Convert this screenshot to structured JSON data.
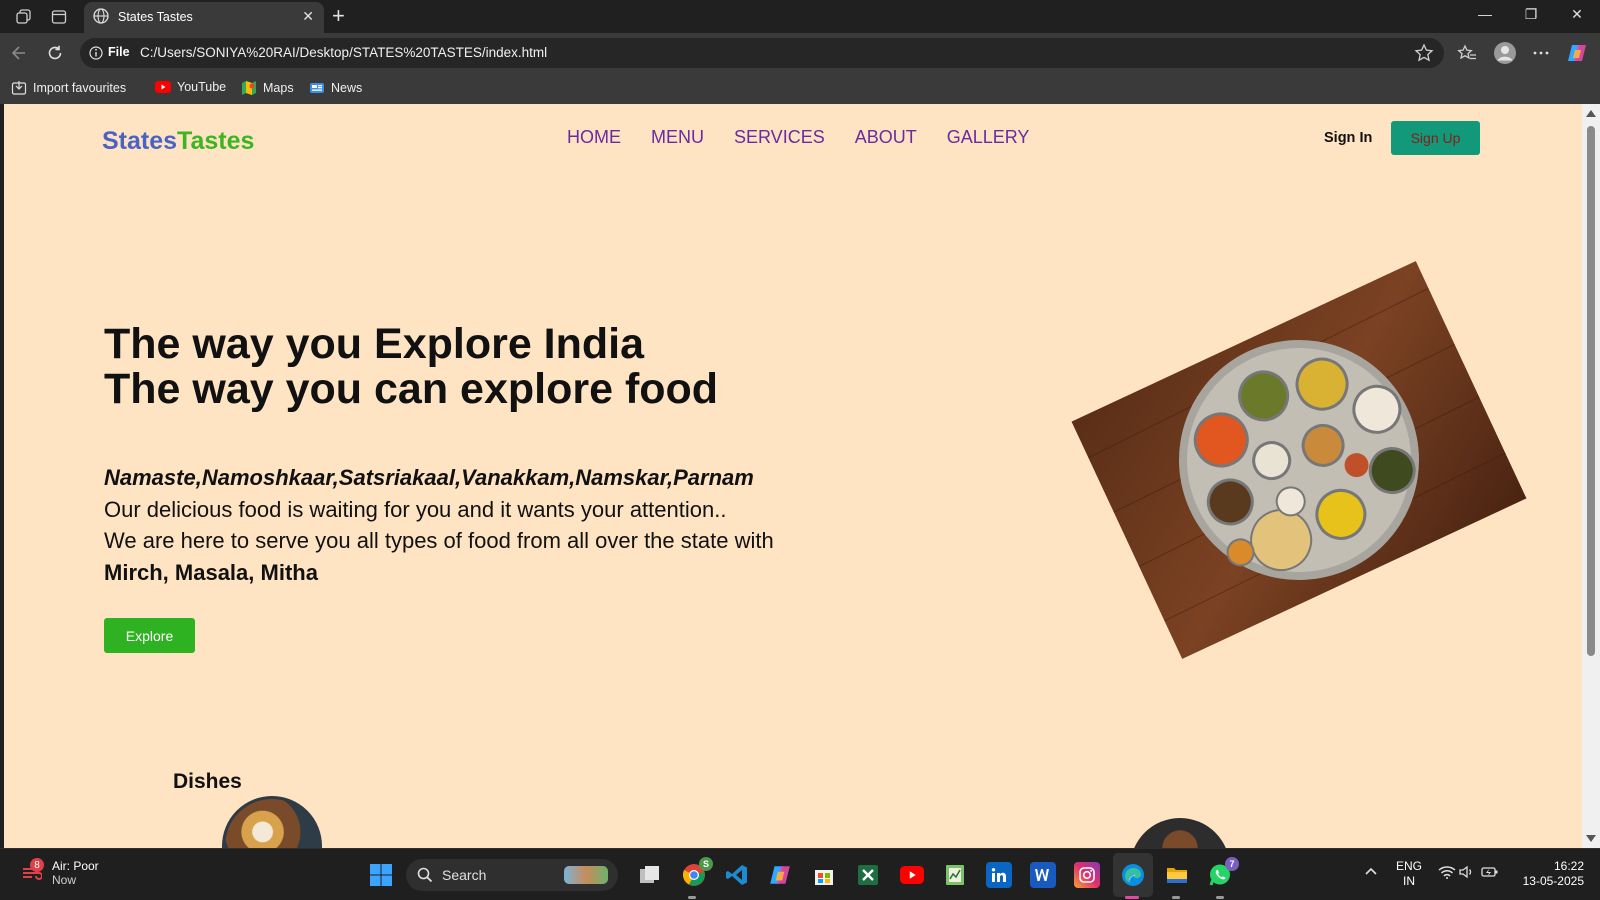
{
  "browser": {
    "tab_title": "States Tastes",
    "url_scheme": "File",
    "url": "C:/Users/SONIYA%20RAI/Desktop/STATES%20TASTES/index.html",
    "favourites": [
      {
        "label": "Import favourites",
        "icon": "import-icon"
      },
      {
        "label": "YouTube",
        "icon": "youtube-icon"
      },
      {
        "label": "Maps",
        "icon": "maps-icon"
      },
      {
        "label": "News",
        "icon": "news-icon"
      }
    ]
  },
  "page": {
    "logo_part1": "States",
    "logo_part2": "Tastes",
    "menu": [
      "HOME",
      "MENU",
      "SERVICES",
      "ABOUT",
      "GALLERY"
    ],
    "sign_in": "Sign In",
    "sign_up": "Sign Up",
    "hero_line1": "The way you Explore India",
    "hero_line2": "The way you can explore food",
    "greeting": "Namaste,Namoshkaar,Satsriakaal,Vanakkam,Namskar,Parnam",
    "body_line1": "Our delicious food is waiting for you and it wants your attention..",
    "body_line2": "We are here to serve you all types of food from all over the state with",
    "body_line3": "Mirch, Masala, Mitha",
    "explore_button": "Explore",
    "dishes_title": "Dishes"
  },
  "taskbar": {
    "air_title": "Air: Poor",
    "air_sub": "Now",
    "air_badge": "8",
    "search_placeholder": "Search",
    "chrome_badge": "S",
    "whatsapp_badge": "7",
    "lang_line1": "ENG",
    "lang_line2": "IN",
    "time": "16:22",
    "date": "13-05-2025"
  },
  "colors": {
    "page_bg": "#ffe4c4",
    "logo_states": "#4a63c2",
    "logo_tastes": "#3cb521",
    "menu_link": "#6b2aa0",
    "signup_bg": "#11997a",
    "explore_bg": "#2fb221"
  }
}
